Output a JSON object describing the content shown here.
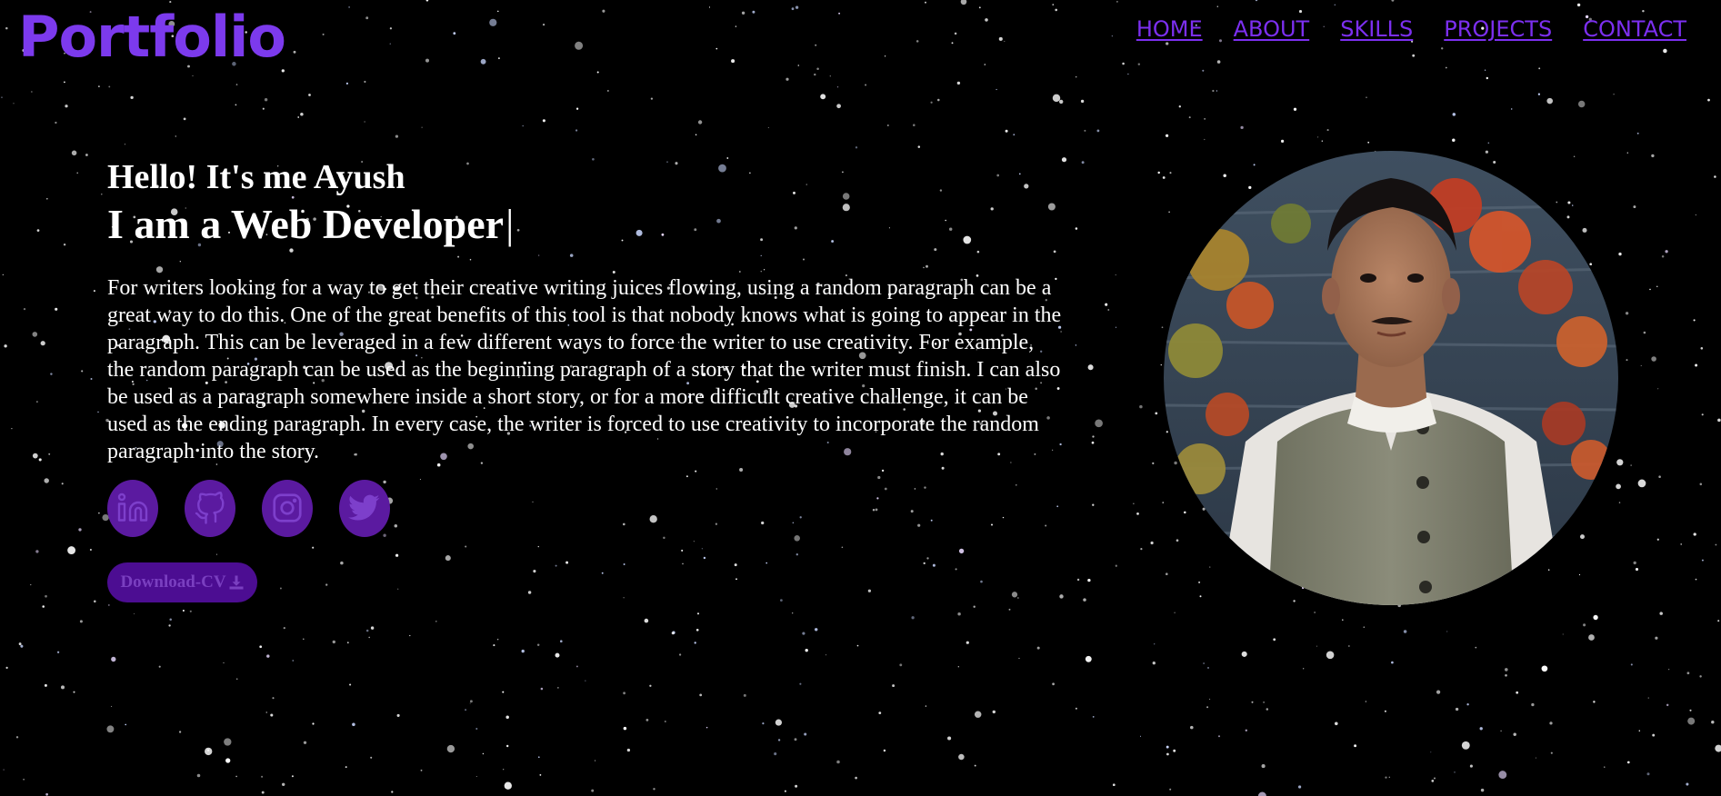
{
  "header": {
    "logo": "Portfolio",
    "nav": [
      {
        "label": "HOME"
      },
      {
        "label": "ABOUT"
      },
      {
        "label": "SKILLS"
      },
      {
        "label": "PROJECTS"
      },
      {
        "label": "CONTACT"
      }
    ]
  },
  "hero": {
    "greeting": "Hello! It's me Ayush",
    "role": "I am a Web Developer",
    "cursor": "|",
    "paragraph": "For writers looking for a way to get their creative writing juices flowing, using a random paragraph can be a great way to do this. One of the great benefits of this tool is that nobody knows what is going to appear in the paragraph. This can be leveraged in a few different ways to force the writer to use creativity. For example, the random paragraph can be used as the beginning paragraph of a story that the writer must finish. I can also be used as a paragraph somewhere inside a short story, or for a more difficult creative challenge, it can be used as the ending paragraph. In every case, the writer is forced to use creativity to incorporate the random paragraph into the story.",
    "socials": [
      {
        "icon": "linkedin-icon"
      },
      {
        "icon": "github-icon"
      },
      {
        "icon": "instagram-icon"
      },
      {
        "icon": "twitter-icon"
      }
    ],
    "cv_button": {
      "label": "Download-CV",
      "icon": "download-icon"
    }
  },
  "profile": {
    "image": "profile-photo"
  },
  "colors": {
    "accent": "#7c3aed",
    "nav": "#7c2ff0",
    "social_bg": "#5b1aa0",
    "button_bg": "#4c0d92",
    "background": "#000000"
  }
}
